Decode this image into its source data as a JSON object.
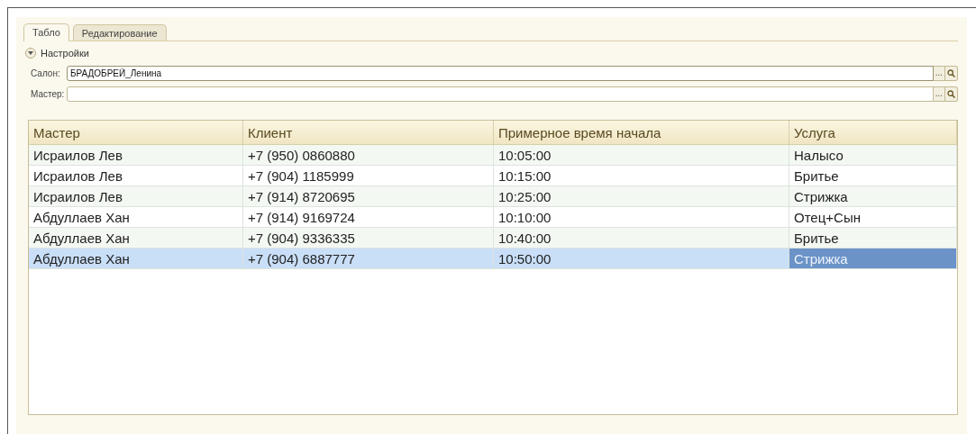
{
  "tabs": [
    {
      "label": "Табло",
      "selected": true
    },
    {
      "label": "Редактирование",
      "selected": false
    }
  ],
  "settings": {
    "label": "Настройки",
    "expanded": true
  },
  "fields": [
    {
      "label": "Салон:",
      "value": "БРАДОБРЕЙ_Ленина",
      "focused": true,
      "select_button": "..."
    },
    {
      "label": "Мастер:",
      "focused": false,
      "select_button": "..."
    }
  ],
  "table": {
    "columns": [
      "Мастер",
      "Клиент",
      "Примерное время начала",
      "Услуга"
    ],
    "rows": [
      {
        "selected": false,
        "cells": [
          {
            "text": "Исраилов Лев",
            "current": false
          },
          {
            "text": "+7 (950) 0860880",
            "current": false
          },
          {
            "text": "10:05:00",
            "current": false
          },
          {
            "text": "Налысо",
            "current": false
          }
        ]
      },
      {
        "selected": false,
        "cells": [
          {
            "text": "Исраилов Лев",
            "current": false
          },
          {
            "text": "+7 (904) 1185999",
            "current": false
          },
          {
            "text": "10:15:00",
            "current": false
          },
          {
            "text": "Бритье",
            "current": false
          }
        ]
      },
      {
        "selected": false,
        "cells": [
          {
            "text": "Исраилов Лев",
            "current": false
          },
          {
            "text": "+7 (914) 8720695",
            "current": false
          },
          {
            "text": "10:25:00",
            "current": false
          },
          {
            "text": "Стрижка",
            "current": false
          }
        ]
      },
      {
        "selected": false,
        "cells": [
          {
            "text": "Абдуллаев Хан",
            "current": false
          },
          {
            "text": "+7 (914) 9169724",
            "current": false
          },
          {
            "text": "10:10:00",
            "current": false
          },
          {
            "text": "Отец+Сын",
            "current": false
          }
        ]
      },
      {
        "selected": false,
        "cells": [
          {
            "text": "Абдуллаев Хан",
            "current": false
          },
          {
            "text": "+7 (904) 9336335",
            "current": false
          },
          {
            "text": "10:40:00",
            "current": false
          },
          {
            "text": "Бритье",
            "current": false
          }
        ]
      },
      {
        "selected": true,
        "cells": [
          {
            "text": "Абдуллаев Хан",
            "current": false
          },
          {
            "text": "+7 (904) 6887777",
            "current": false
          },
          {
            "text": "10:50:00",
            "current": false
          },
          {
            "text": "Стрижка",
            "current": true
          }
        ]
      }
    ]
  }
}
